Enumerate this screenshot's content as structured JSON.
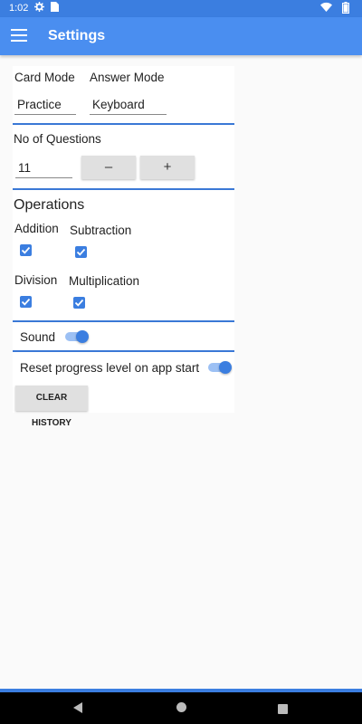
{
  "status_bar": {
    "time": "1:02",
    "icons": [
      "gear-icon",
      "sim-icon",
      "wifi-icon",
      "battery-icon"
    ]
  },
  "app_bar": {
    "title": "Settings",
    "menu_icon": "hamburger-menu-icon"
  },
  "settings": {
    "card_mode_label": "Card Mode",
    "answer_mode_label": "Answer Mode",
    "card_mode_value": "Practice",
    "answer_mode_value": "Keyboard",
    "questions_label": "No of Questions",
    "questions_value": "11",
    "minus_label": "–",
    "plus_label": "+",
    "operations_heading": "Operations",
    "operations": {
      "addition": "Addition",
      "subtraction": "Subtraction",
      "division": "Division",
      "multiplication": "Multiplication"
    },
    "sound_label": "Sound",
    "reset_label": "Reset progress level on app start",
    "clear_history_label": "CLEAR HISTORY"
  },
  "colors": {
    "primary": "#4a8ef0",
    "accent": "#3b7ee0"
  }
}
